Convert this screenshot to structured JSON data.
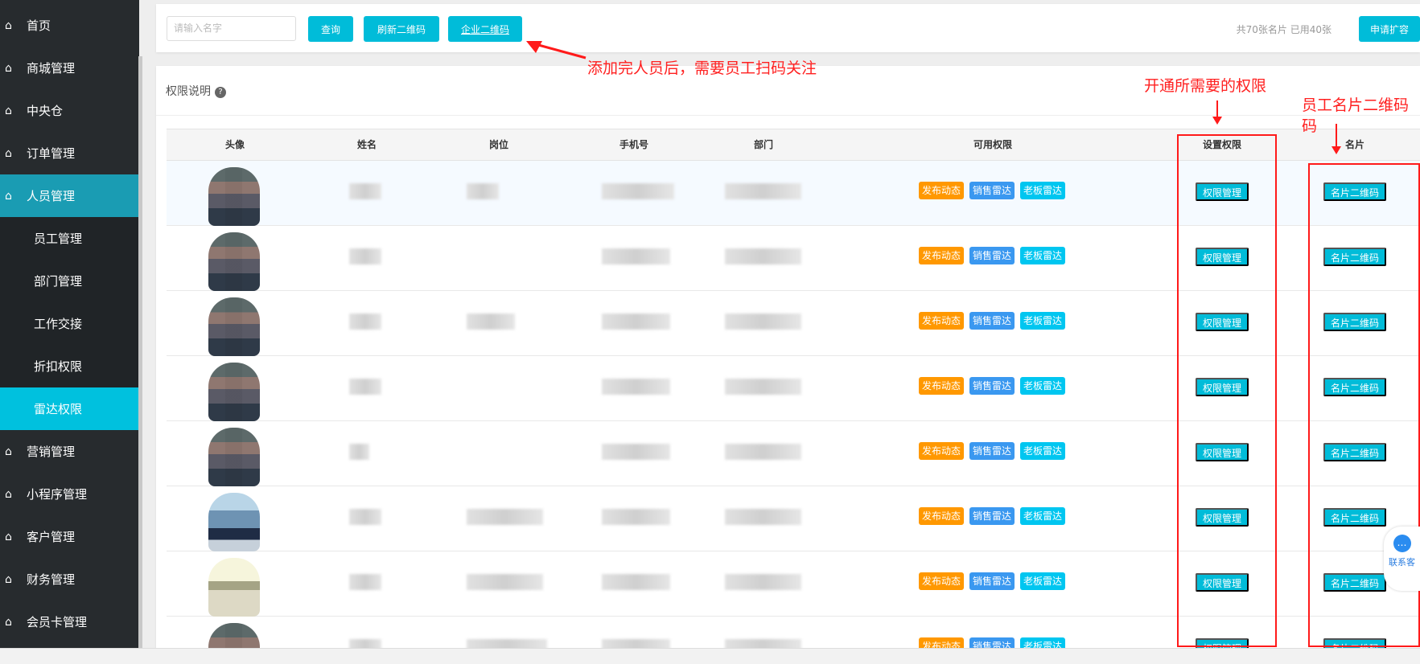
{
  "sidebar": {
    "items": [
      {
        "label": "首页",
        "icon": "home-icon"
      },
      {
        "label": "商城管理",
        "icon": "home-icon"
      },
      {
        "label": "中央仓",
        "icon": "home-icon"
      },
      {
        "label": "订单管理",
        "icon": "home-icon"
      },
      {
        "label": "人员管理",
        "icon": "home-icon",
        "active": true
      },
      {
        "label": "员工管理",
        "sub": true
      },
      {
        "label": "部门管理",
        "sub": true
      },
      {
        "label": "工作交接",
        "sub": true
      },
      {
        "label": "折扣权限",
        "sub": true
      },
      {
        "label": "雷达权限",
        "sub": true,
        "active": true
      },
      {
        "label": "营销管理",
        "icon": "home-icon"
      },
      {
        "label": "小程序管理",
        "icon": "home-icon"
      },
      {
        "label": "客户管理",
        "icon": "home-icon"
      },
      {
        "label": "财务管理",
        "icon": "home-icon"
      },
      {
        "label": "会员卡管理",
        "icon": "home-icon"
      }
    ]
  },
  "toolbar": {
    "search_placeholder": "请输入名字",
    "query": "查询",
    "refresh_qr": "刷新二维码",
    "company_qr": "企业二维码",
    "quota": "共70张名片 已用40张",
    "apply": "申请扩容"
  },
  "section": {
    "title": "权限说明",
    "help": "?"
  },
  "table": {
    "headers": [
      "头像",
      "姓名",
      "岗位",
      "手机号",
      "部门",
      "可用权限",
      "设置权限",
      "名片"
    ],
    "tags": [
      "发布动态",
      "销售雷达",
      "老板雷达"
    ],
    "set_button": "权限管理",
    "card_button": "名片二维码",
    "row_count": 8
  },
  "annotations": {
    "a1": "添加完人员后，需要员工扫码关注",
    "a2": "开通所需要的权限",
    "a3": "员工名片二维码",
    "a3b": "码"
  },
  "contact": {
    "label": "联系客"
  },
  "colors": {
    "accent": "#00bcd9",
    "orange": "#ff9800",
    "blue": "#3a98f0",
    "cyan": "#00c6f0",
    "annotation": "#ff1a1a"
  }
}
